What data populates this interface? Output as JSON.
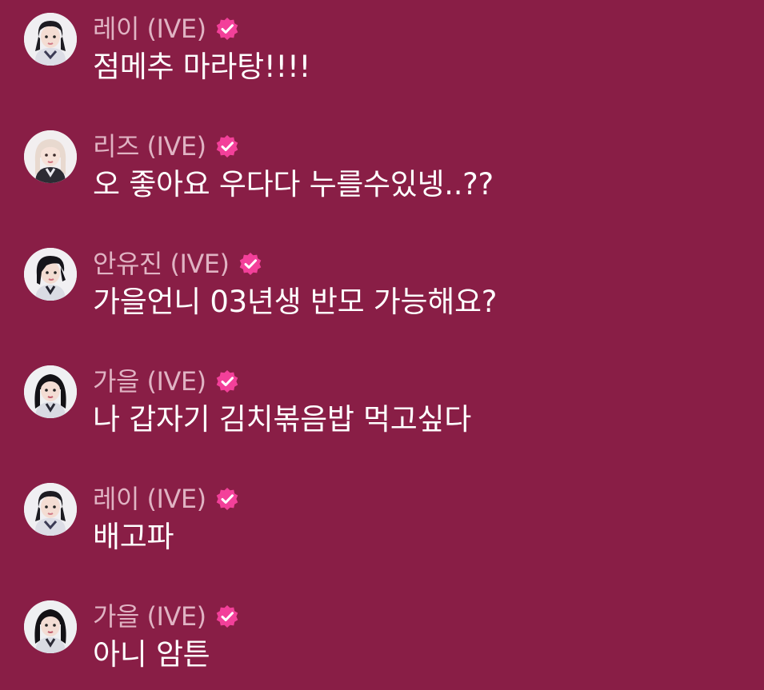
{
  "colors": {
    "background": "#891e46",
    "name_text": "#e0b3c3",
    "message_text": "#ffffff",
    "verified_badge": "#f3409a"
  },
  "icons": {
    "verified": "verified-badge-icon",
    "avatar": "avatar-image"
  },
  "messages": [
    {
      "name": "레이 (IVE)",
      "text": "점메추 마라탕!!!!",
      "avatar": "rei"
    },
    {
      "name": "리즈 (IVE)",
      "text": "오 좋아요 우다다 누를수있넹..??",
      "avatar": "liz"
    },
    {
      "name": "안유진 (IVE)",
      "text": "가을언니 03년생 반모 가능해요?",
      "avatar": "yujin"
    },
    {
      "name": "가을 (IVE)",
      "text": "나 갑자기 김치볶음밥 먹고싶다",
      "avatar": "gaeul"
    },
    {
      "name": "레이 (IVE)",
      "text": "배고파",
      "avatar": "rei"
    },
    {
      "name": "가을 (IVE)",
      "text": "아니 암튼",
      "avatar": "gaeul"
    }
  ]
}
